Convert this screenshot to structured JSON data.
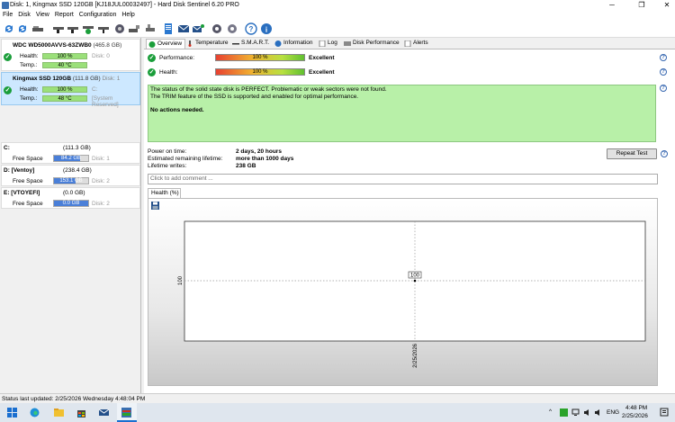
{
  "window": {
    "title": "Disk: 1, Kingmax SSD 120GB [KJ18JUL00032497]  -  Hard Disk Sentinel 6.20 PRO",
    "minimize": "─",
    "maximize": "❐",
    "close": "✕"
  },
  "menu": [
    "File",
    "Disk",
    "View",
    "Report",
    "Configuration",
    "Help"
  ],
  "disks": [
    {
      "name": "WDC WD5000AVVS-63ZWB0",
      "size": "(465.8 GB)",
      "health_label": "Health:",
      "health": "100 %",
      "health_fraction": 1.0,
      "disk_ref": "Disk: 0",
      "temp_label": "Temp.:",
      "temp": "40 °C",
      "temp_fraction": 0.4,
      "extra": ""
    },
    {
      "name": "Kingmax SSD 120GB",
      "size": "(111.8 GB)",
      "disk_ref_inline": "Disk: 1",
      "health_label": "Health:",
      "health": "100 %",
      "health_fraction": 1.0,
      "disk_ref": "C:",
      "temp_label": "Temp.:",
      "temp": "48 °C",
      "temp_fraction": 0.48,
      "extra": "[System Reserved]"
    }
  ],
  "volumes": [
    {
      "name": "C:",
      "size": "(111.3 GB)",
      "free_label": "Free Space",
      "free": "84.2 GB",
      "free_fraction": 0.76,
      "disk": "Disk: 1"
    },
    {
      "name": "D: [Ventoy]",
      "size": "(238.4 GB)",
      "free_label": "Free Space",
      "free": "153.1 GB",
      "free_fraction": 0.64,
      "disk": "Disk: 2"
    },
    {
      "name": "E: [VTOYEFI]",
      "size": "(0.0 GB)",
      "free_label": "Free Space",
      "free": "0.0 GB",
      "free_fraction": 1.0,
      "disk": "Disk: 2"
    }
  ],
  "tabs": [
    "Overview",
    "Temperature",
    "S.M.A.R.T.",
    "Information",
    "Log",
    "Disk Performance",
    "Alerts"
  ],
  "overview": {
    "performance_label": "Performance:",
    "performance_value": "100 %",
    "performance_text": "Excellent",
    "health_label": "Health:",
    "health_value": "100 %",
    "health_text": "Excellent",
    "status_line1": "The status of the solid state disk is PERFECT. Problematic or weak sectors were not found.",
    "status_line2": "The TRIM feature of the SSD is supported and enabled for optimal performance.",
    "status_line3": "No actions needed.",
    "power_on_label": "Power on time:",
    "power_on_value": "2 days, 20 hours",
    "lifetime_label": "Estimated remaining lifetime:",
    "lifetime_value": "more than 1000 days",
    "writes_label": "Lifetime writes:",
    "writes_value": "238 GB",
    "repeat_button": "Repeat Test",
    "comment_placeholder": "Click to add comment ...",
    "health_tab": "Health (%)",
    "help": "?"
  },
  "chart_data": {
    "type": "line",
    "x": [
      "2/25/2026"
    ],
    "series": [
      {
        "values": [
          100
        ]
      }
    ],
    "data_labels": [
      "100"
    ],
    "y_tick_labels": [
      "100"
    ],
    "x_tick_labels": [
      "2/25/2026"
    ]
  },
  "statusbar": "Status last updated: 2/25/2026 Wednesday 4:48:04 PM",
  "taskbar": {
    "lang": "ENG",
    "time": "4:48 PM",
    "date": "2/25/2026"
  },
  "colors": {
    "status_green": "#b8f0a8",
    "ok_green": "#1a9e3a",
    "selected_disk": "#cde8ff",
    "volume_fill": "#4a7fd8"
  }
}
